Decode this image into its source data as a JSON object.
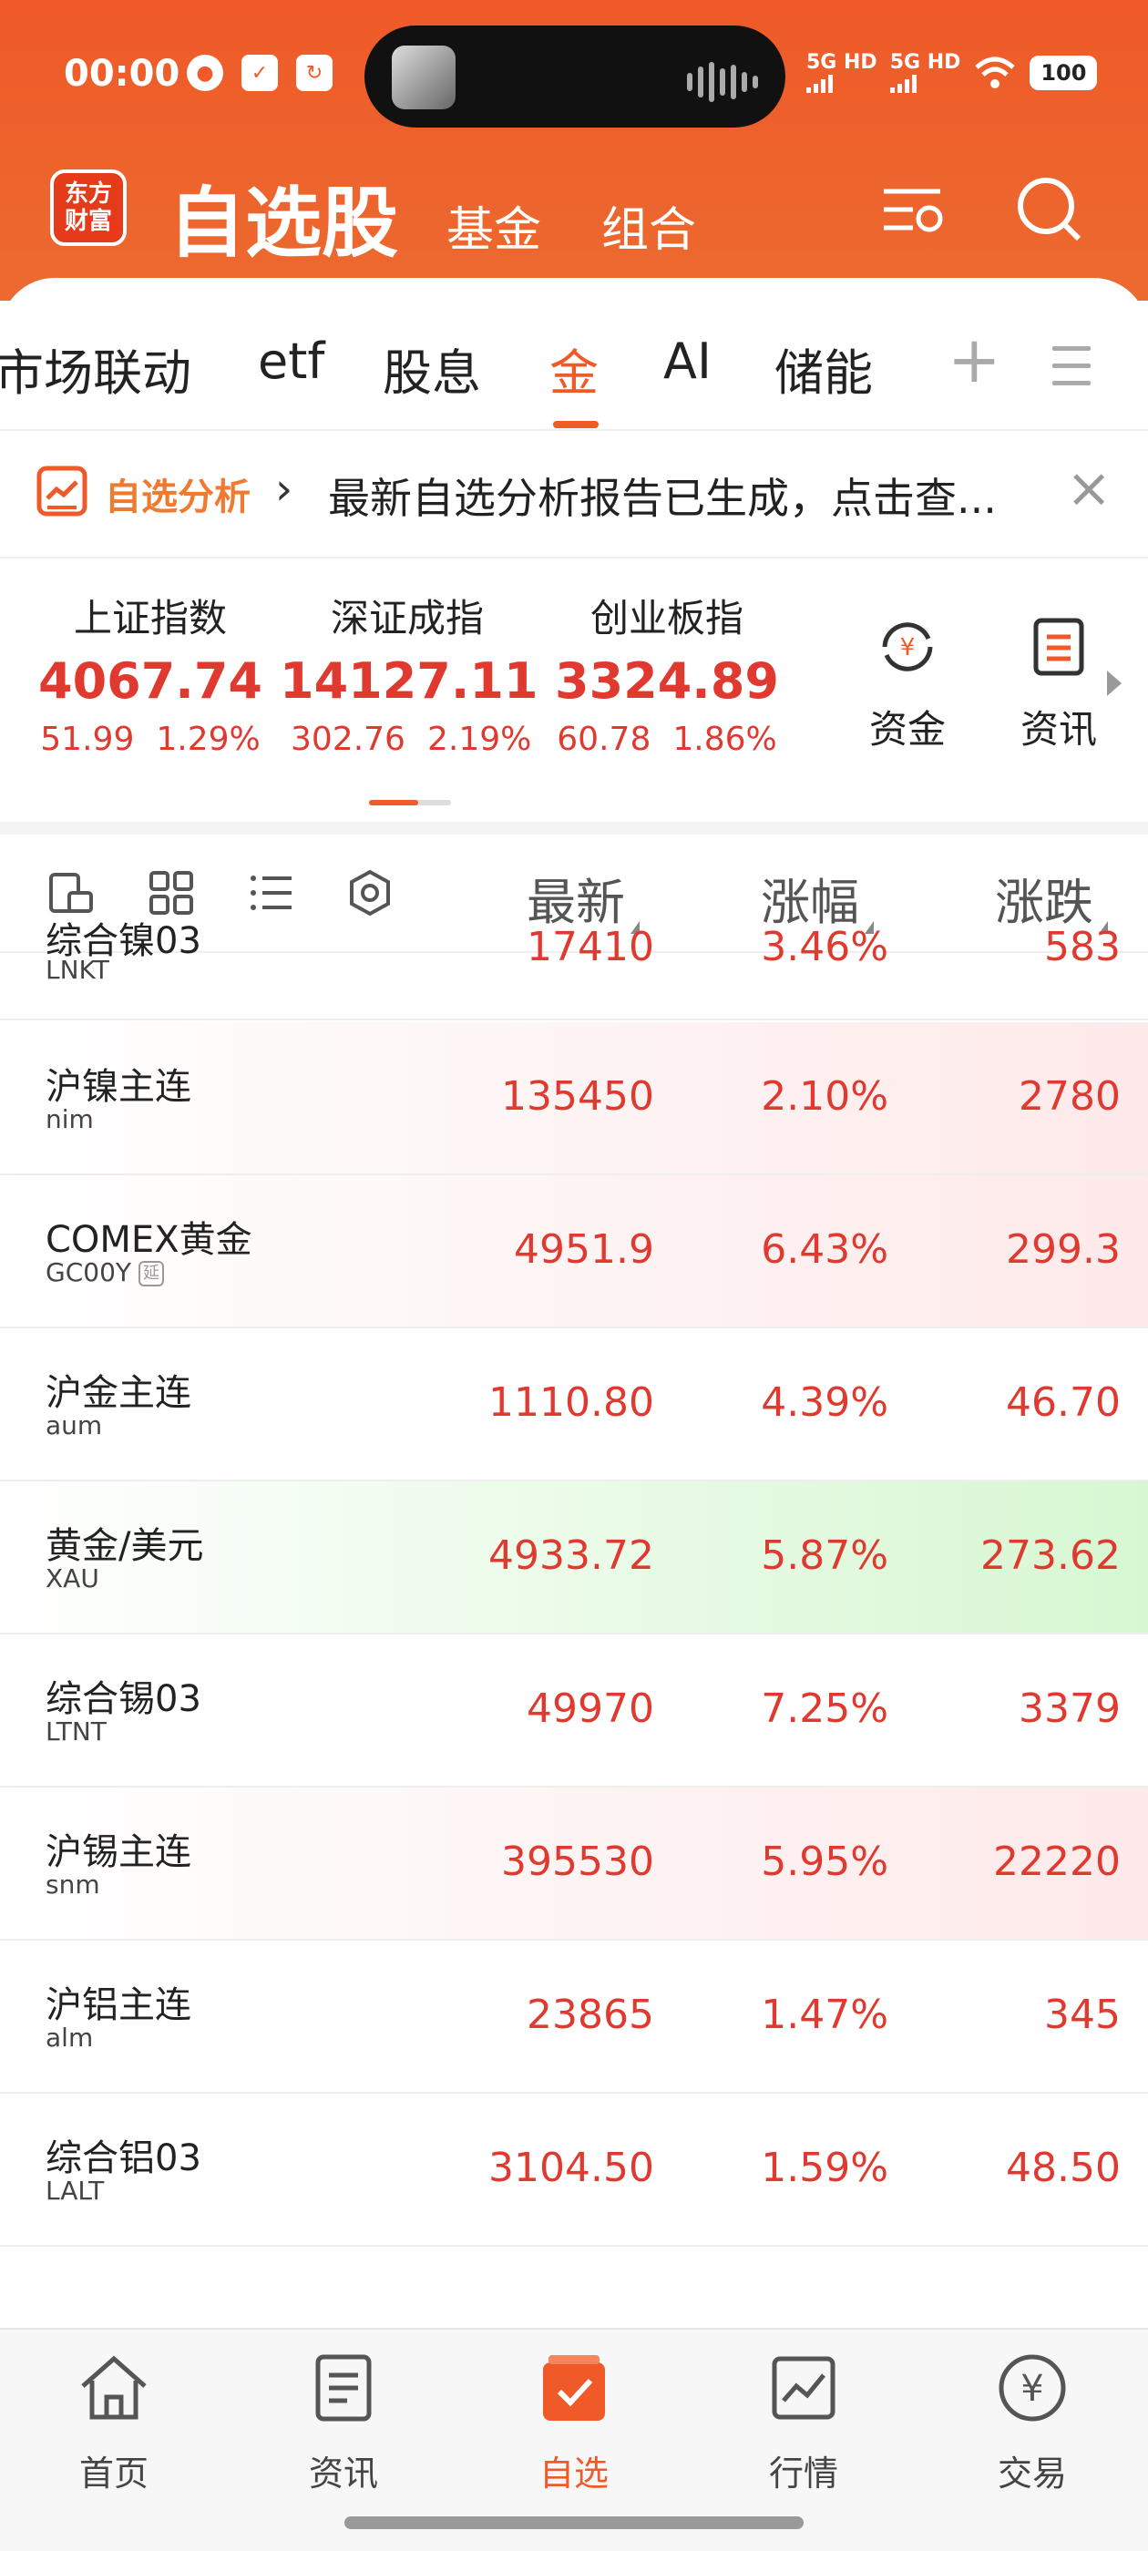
{
  "status_bar": {
    "time": "00:00",
    "network_1": "5G HD",
    "network_2": "5G HD",
    "battery": "100"
  },
  "header": {
    "logo_line1": "东方",
    "logo_line2": "财富",
    "title": "自选股",
    "tab_fund": "基金",
    "tab_portfolio": "组合"
  },
  "group_tabs": [
    "市场联动",
    "etf",
    "股息",
    "金",
    "AI",
    "储能"
  ],
  "active_group_tab": "金",
  "banner": {
    "title": "自选分析",
    "text": "最新自选分析报告已生成，点击查..."
  },
  "indices": [
    {
      "name": "上证指数",
      "value": "4067.74",
      "change": "51.99",
      "percent": "1.29%"
    },
    {
      "name": "深证成指",
      "value": "14127.11",
      "change": "302.76",
      "percent": "2.19%"
    },
    {
      "name": "创业板指",
      "value": "3324.89",
      "change": "60.78",
      "percent": "1.86%"
    }
  ],
  "index_buttons": {
    "capital": "资金",
    "news": "资讯"
  },
  "columns": {
    "latest": "最新",
    "change_pct": "涨幅",
    "change": "涨跌"
  },
  "rows": [
    {
      "name": "综合镍03",
      "code": "LNKT",
      "latest": "17410",
      "pct": "3.46%",
      "chg": "583",
      "delayed": false
    },
    {
      "name": "沪镍主连",
      "code": "nim",
      "latest": "135450",
      "pct": "2.10%",
      "chg": "2780",
      "delayed": false
    },
    {
      "name": "COMEX黄金",
      "code": "GC00Y",
      "latest": "4951.9",
      "pct": "6.43%",
      "chg": "299.3",
      "delayed": true
    },
    {
      "name": "沪金主连",
      "code": "aum",
      "latest": "1110.80",
      "pct": "4.39%",
      "chg": "46.70",
      "delayed": false
    },
    {
      "name": "黄金/美元",
      "code": "XAU",
      "latest": "4933.72",
      "pct": "5.87%",
      "chg": "273.62",
      "delayed": false
    },
    {
      "name": "综合锡03",
      "code": "LTNT",
      "latest": "49970",
      "pct": "7.25%",
      "chg": "3379",
      "delayed": false
    },
    {
      "name": "沪锡主连",
      "code": "snm",
      "latest": "395530",
      "pct": "5.95%",
      "chg": "22220",
      "delayed": false
    },
    {
      "name": "沪铝主连",
      "code": "alm",
      "latest": "23865",
      "pct": "1.47%",
      "chg": "345",
      "delayed": false
    },
    {
      "name": "综合铝03",
      "code": "LALT",
      "latest": "3104.50",
      "pct": "1.59%",
      "chg": "48.50",
      "delayed": false
    }
  ],
  "delay_badge": "延",
  "bottom_nav": [
    {
      "label": "首页",
      "icon": "home-icon"
    },
    {
      "label": "资讯",
      "icon": "news-icon"
    },
    {
      "label": "自选",
      "icon": "watchlist-icon"
    },
    {
      "label": "行情",
      "icon": "market-icon"
    },
    {
      "label": "交易",
      "icon": "trade-icon"
    }
  ],
  "active_nav": "自选",
  "colors": {
    "brand": "#ef5a28",
    "up": "#e03a30"
  }
}
